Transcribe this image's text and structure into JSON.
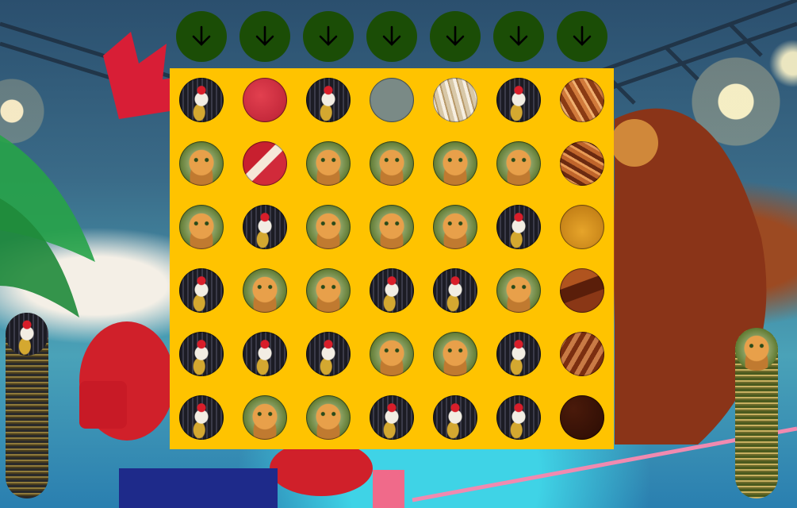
{
  "game": {
    "columns": 7,
    "rows": 6,
    "board_color": "#ffc300",
    "button_color": "#1b4d06",
    "drop_icon": "arrow-down-icon",
    "pieces": {
      "rooster": "rooster-token",
      "cat": "cat-token"
    },
    "grid": [
      [
        "rooster",
        "empty",
        "rooster",
        "empty",
        "empty",
        "rooster",
        "empty"
      ],
      [
        "cat",
        "empty",
        "cat",
        "cat",
        "cat",
        "cat",
        "empty"
      ],
      [
        "cat",
        "rooster",
        "cat",
        "cat",
        "cat",
        "rooster",
        "empty"
      ],
      [
        "rooster",
        "cat",
        "cat",
        "rooster",
        "rooster",
        "cat",
        "empty"
      ],
      [
        "rooster",
        "rooster",
        "rooster",
        "cat",
        "cat",
        "rooster",
        "empty"
      ],
      [
        "rooster",
        "cat",
        "cat",
        "rooster",
        "rooster",
        "rooster",
        "empty"
      ]
    ],
    "player_left": {
      "token": "rooster"
    },
    "player_right": {
      "token": "cat"
    }
  }
}
